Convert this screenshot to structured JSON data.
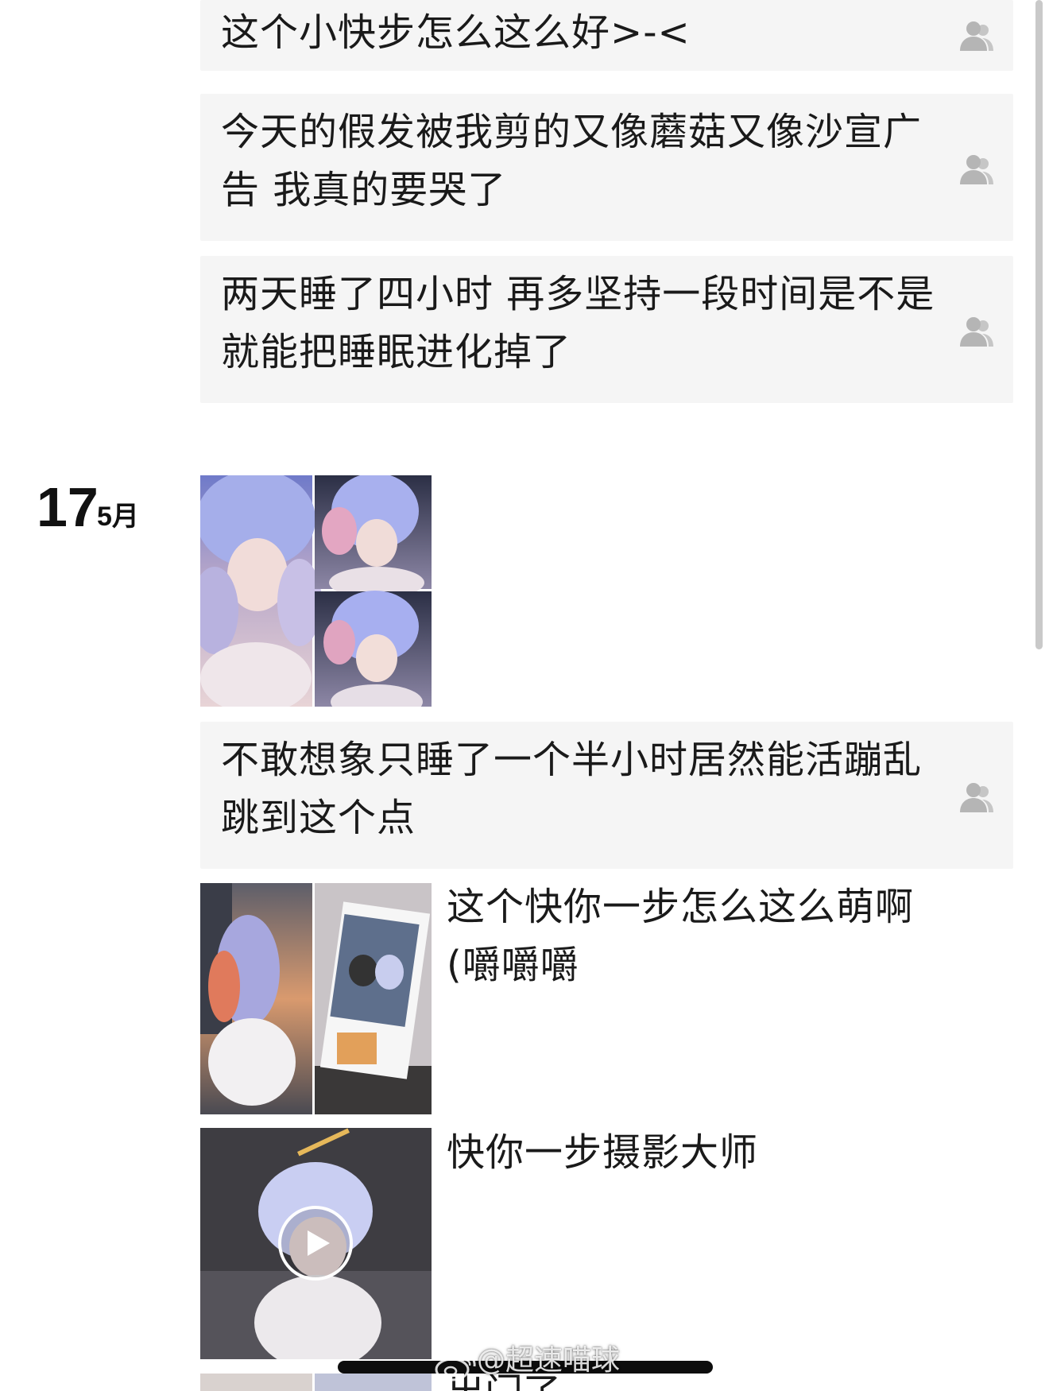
{
  "feed": {
    "posts_top": [
      {
        "text": "这个小快步怎么这么好>-<",
        "icon": "people-icon"
      },
      {
        "text": "今天的假发被我剪的又像蘑菇又像沙宣广告 我真的要哭了",
        "icon": "people-icon"
      },
      {
        "text": "两天睡了四小时 再多坚持一段时间是不是就能把睡眠进化掉了",
        "icon": "people-icon"
      }
    ],
    "date": {
      "day": "17",
      "month": "5月"
    },
    "posts_bottom": [
      {
        "text": "不敢想象只睡了一个半小时居然能活蹦乱跳到这个点",
        "icon": "people-icon"
      },
      {
        "text": "这个快你一步怎么这么萌啊(嚼嚼嚼",
        "icon": "people-icon"
      },
      {
        "text": "快你一步摄影大师",
        "icon": "play-icon"
      },
      {
        "text": "出门了",
        "icon": "people-icon"
      }
    ]
  },
  "watermark": {
    "text": "@超速喵球",
    "icon": "weibo-logo-icon"
  },
  "colors": {
    "card_bg": "#f5f5f5",
    "text": "#1a1a1a",
    "icon_gray": "#b5b5b5",
    "accent_hair": "#9ea6e6"
  }
}
